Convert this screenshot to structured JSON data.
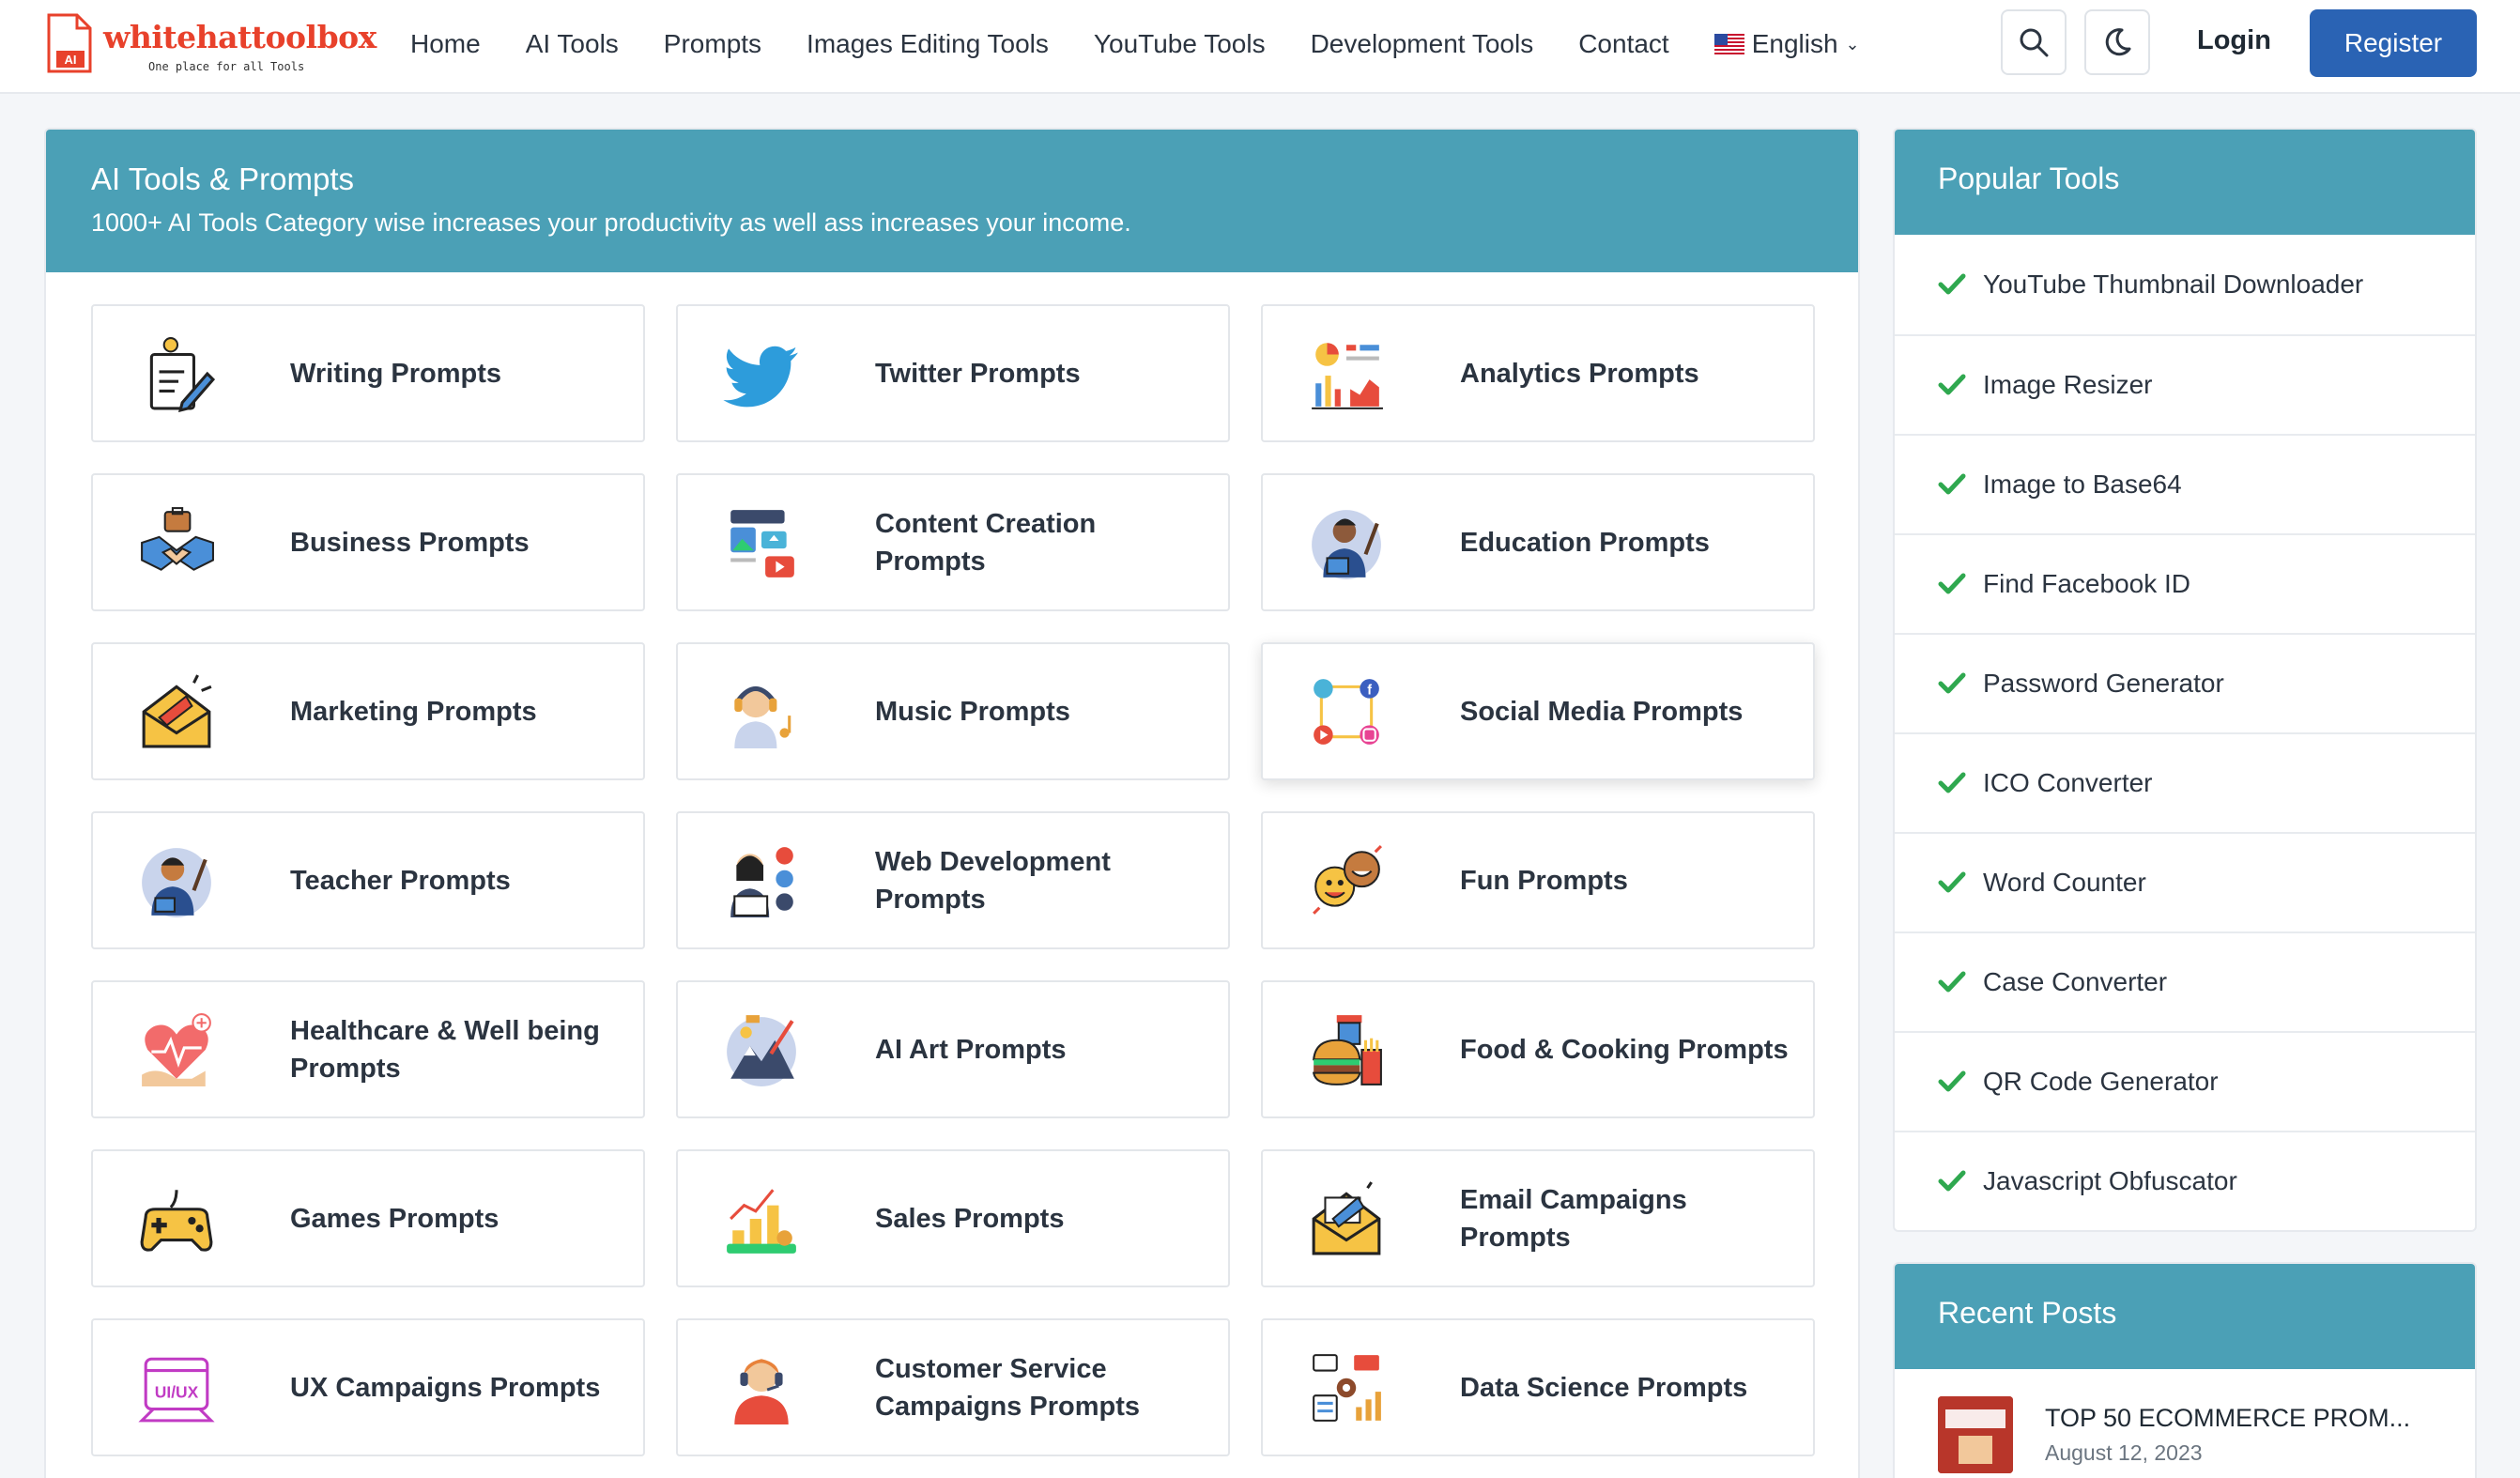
{
  "brand": {
    "name": "whitehattoolbox",
    "tagline": "One place for all Tools",
    "badge": "AI",
    "color": "#e8412b"
  },
  "nav": {
    "links": [
      "Home",
      "AI Tools",
      "Prompts",
      "Images Editing Tools",
      "YouTube Tools",
      "Development Tools",
      "Contact"
    ],
    "language": "English",
    "login": "Login",
    "register": "Register"
  },
  "main": {
    "title": "AI Tools & Prompts",
    "subtitle": "1000+ AI Tools Category wise increases your productivity as well ass increases your income.",
    "header_color": "#4ba0b6",
    "categories": [
      {
        "label": "Writing Prompts",
        "icon": "writing-icon"
      },
      {
        "label": "Twitter Prompts",
        "icon": "twitter-icon"
      },
      {
        "label": "Analytics Prompts",
        "icon": "analytics-icon"
      },
      {
        "label": "Business Prompts",
        "icon": "handshake-icon"
      },
      {
        "label": "Content Creation Prompts",
        "icon": "content-creation-icon"
      },
      {
        "label": "Education Prompts",
        "icon": "education-icon"
      },
      {
        "label": "Marketing Prompts",
        "icon": "marketing-icon"
      },
      {
        "label": "Music Prompts",
        "icon": "music-icon"
      },
      {
        "label": "Social Media Prompts",
        "icon": "social-media-icon"
      },
      {
        "label": "Teacher Prompts",
        "icon": "teacher-icon"
      },
      {
        "label": "Web Development Prompts",
        "icon": "web-development-icon"
      },
      {
        "label": "Fun Prompts",
        "icon": "fun-icon"
      },
      {
        "label": "Healthcare & Well being Prompts",
        "icon": "healthcare-icon"
      },
      {
        "label": "AI Art Prompts",
        "icon": "ai-art-icon"
      },
      {
        "label": "Food & Cooking Prompts",
        "icon": "food-icon"
      },
      {
        "label": "Games Prompts",
        "icon": "gamepad-icon"
      },
      {
        "label": "Sales Prompts",
        "icon": "sales-icon"
      },
      {
        "label": "Email Campaigns Prompts",
        "icon": "email-icon"
      },
      {
        "label": "UX Campaigns Prompts",
        "icon": "ux-icon"
      },
      {
        "label": "Customer Service Campaigns Prompts",
        "icon": "customer-service-icon"
      },
      {
        "label": "Data Science Prompts",
        "icon": "data-science-icon"
      }
    ]
  },
  "popular": {
    "title": "Popular Tools",
    "items": [
      "YouTube Thumbnail Downloader",
      "Image Resizer",
      "Image to Base64",
      "Find Facebook ID",
      "Password Generator",
      "ICO Converter",
      "Word Counter",
      "Case Converter",
      "QR Code Generator",
      "Javascript Obfuscator"
    ]
  },
  "recent": {
    "title": "Recent Posts",
    "posts": [
      {
        "title": "TOP 50 ECOMMERCE PROM...",
        "date": "August 12, 2023"
      }
    ]
  }
}
